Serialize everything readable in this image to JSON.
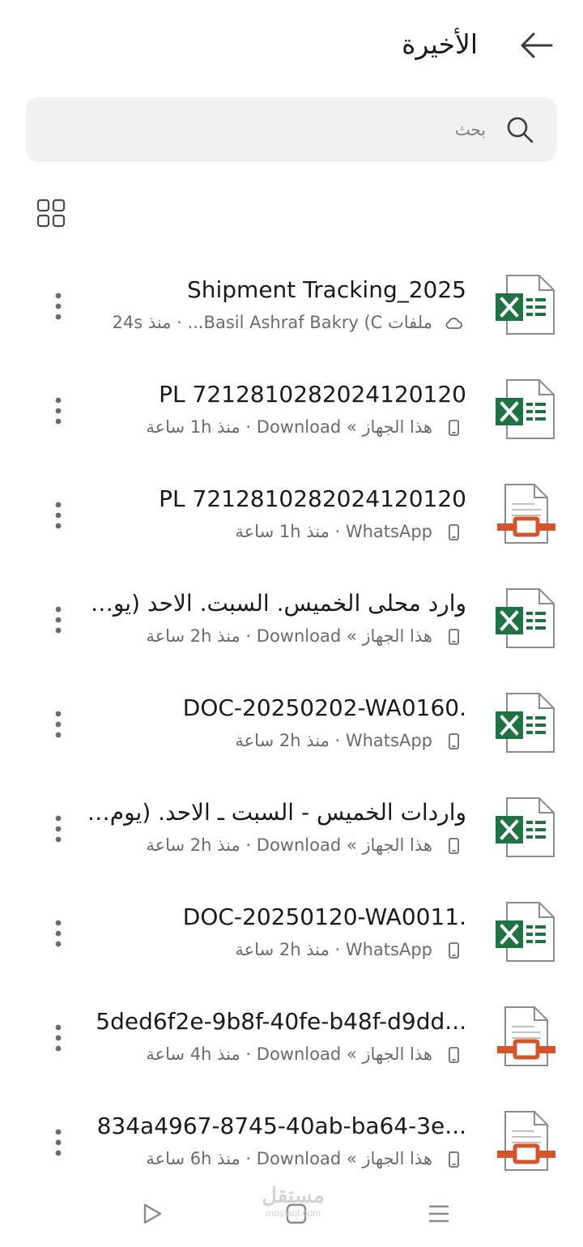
{
  "header": {
    "title": "الأخيرة",
    "back_icon": "arrow-left-icon"
  },
  "search": {
    "placeholder": "بحث",
    "value": ""
  },
  "view_toggle": {
    "icon": "grid-view-icon"
  },
  "files": [
    {
      "name": "Shipment Tracking_2025",
      "type": "excel",
      "location_icon": "cloud",
      "meta": "ملفات Basil Ashraf Bakry (C... · منذ 24s"
    },
    {
      "name": "PL 7212810282024120120",
      "type": "excel",
      "location_icon": "phone",
      "meta": "هذا الجهاز » Download · منذ 1h ساعة"
    },
    {
      "name": "PL 7212810282024120120",
      "type": "doc",
      "location_icon": "phone",
      "meta": "WhatsApp · منذ 1h ساعة"
    },
    {
      "name": "وارد محلى الخميس. السبت. الاحد (يوم ...",
      "type": "excel",
      "location_icon": "phone",
      "meta": "هذا الجهاز » Download · منذ 2h ساعة"
    },
    {
      "name": "DOC-20250202-WA0160.",
      "type": "excel",
      "location_icon": "phone",
      "meta": "WhatsApp · منذ 2h ساعة"
    },
    {
      "name": "واردات الخميس - السبت ـ الاحد. (يوم ...",
      "type": "excel",
      "location_icon": "phone",
      "meta": "هذا الجهاز » Download · منذ 2h ساعة"
    },
    {
      "name": "DOC-20250120-WA0011.",
      "type": "excel",
      "location_icon": "phone",
      "meta": "WhatsApp · منذ 2h ساعة"
    },
    {
      "name": "5ded6f2e-9b8f-40fe-b48f-d9dd...",
      "type": "doc",
      "location_icon": "phone",
      "meta": "هذا الجهاز » Download · منذ 4h ساعة"
    },
    {
      "name": "834a4967-8745-40ab-ba64-3e...",
      "type": "doc",
      "location_icon": "phone",
      "meta": "هذا الجهاز » Download · منذ 6h ساعة"
    }
  ],
  "bottom_nav": {
    "items": [
      {
        "icon": "play-icon"
      },
      {
        "icon": "home-square-icon"
      },
      {
        "icon": "menu-icon"
      }
    ]
  },
  "watermark": {
    "ar": "مستقل",
    "en": "mostaql.com"
  },
  "colors": {
    "excel_green": "#1f7244",
    "doc_orange": "#d4552b",
    "search_bg": "#f1f1f1",
    "meta_gray": "#6b6b6b"
  }
}
